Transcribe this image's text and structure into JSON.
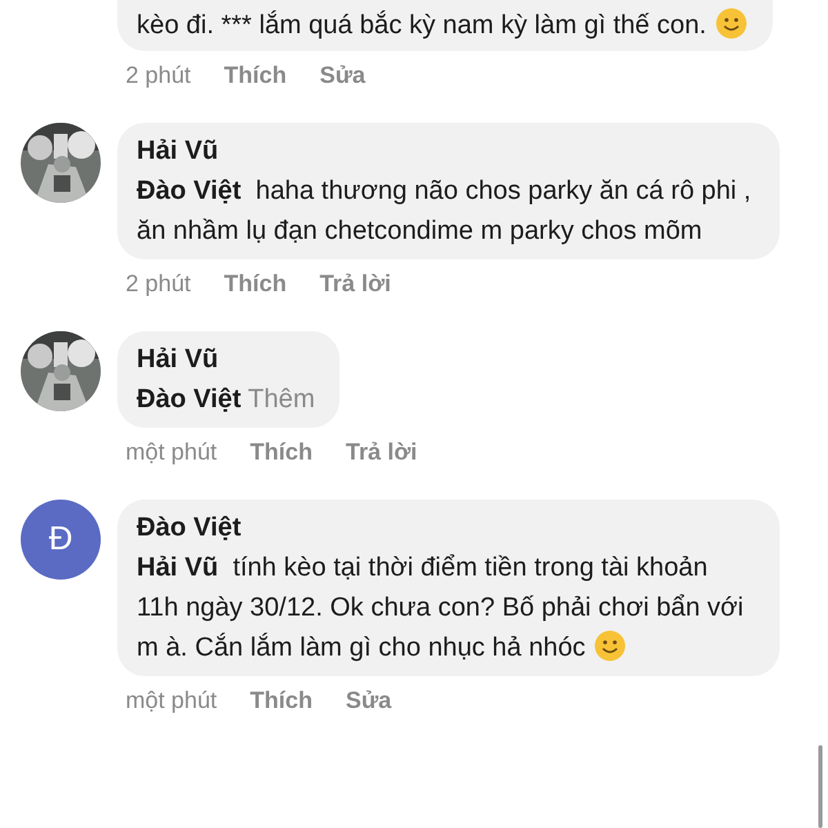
{
  "comments": [
    {
      "cut_top": true,
      "text": "kèo đi. *** lắm quá bắc kỳ nam kỳ làm gì thế con.",
      "emoji": true,
      "actions": {
        "time": "2 phút",
        "like": "Thích",
        "reply": "Sửa"
      }
    },
    {
      "author": "Hải Vũ",
      "mention": "Đào Việt",
      "text": "haha thương não chos parky ăn cá rô phi , ăn nhầm lụ đạn chetcondime m parky chos mõm",
      "actions": {
        "time": "2 phút",
        "like": "Thích",
        "reply": "Trả lời"
      }
    },
    {
      "author": "Hải Vũ",
      "mention": "Đào Việt",
      "see_more": "Thêm",
      "actions": {
        "time": "một phút",
        "like": "Thích",
        "reply": "Trả lời"
      }
    },
    {
      "avatar": {
        "kind": "letter",
        "letter": "Đ"
      },
      "author": "Đào Việt",
      "mention": "Hải Vũ",
      "text": "tính kèo tại thời điểm tiền trong tài khoản 11h ngày 30/12. Ok chưa con? Bố phải chơi bẩn với m à. Cắn lắm làm gì cho nhục hả nhóc",
      "emoji": true,
      "actions": {
        "time": "một phút",
        "like": "Thích",
        "reply": "Sửa"
      }
    }
  ]
}
